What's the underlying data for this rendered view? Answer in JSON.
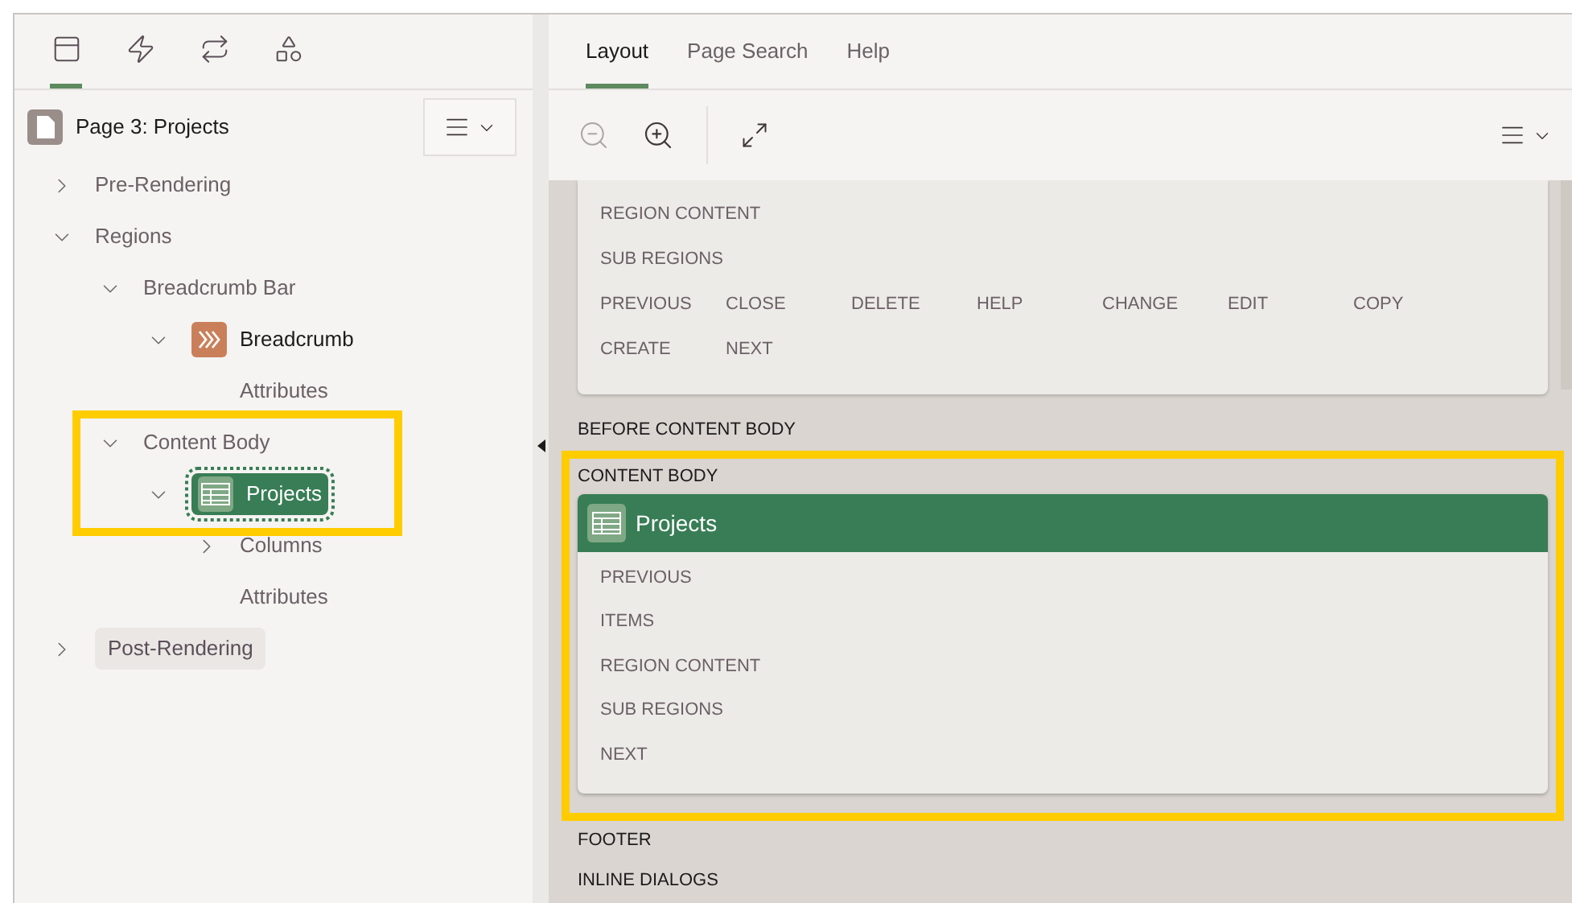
{
  "left_tabs": [
    {
      "selected": true
    },
    {
      "selected": false
    },
    {
      "selected": false
    },
    {
      "selected": false
    }
  ],
  "page_title": "Page 3: Projects",
  "tree": [
    {
      "label": "Pre-Rendering",
      "kind": "folder",
      "expanded": false,
      "selected": false
    },
    {
      "label": "Regions",
      "kind": "folder",
      "expanded": true,
      "selected": false,
      "children": [
        {
          "label": "Breadcrumb Bar",
          "kind": "folder",
          "expanded": true,
          "selected": false,
          "children": [
            {
              "label": "Breadcrumb",
              "kind": "breadcrumb-region",
              "expanded": true,
              "selected": false,
              "children": [
                {
                  "label": "Attributes",
                  "kind": "leaf",
                  "selected": false
                }
              ]
            }
          ]
        },
        {
          "label": "Content Body",
          "kind": "folder",
          "expanded": true,
          "selected": false,
          "highlighted": true,
          "children": [
            {
              "label": "Projects",
              "kind": "table-region",
              "expanded": true,
              "selected": true,
              "children": [
                {
                  "label": "Columns",
                  "kind": "folder",
                  "expanded": false,
                  "selected": false
                },
                {
                  "label": "Attributes",
                  "kind": "leaf",
                  "selected": false
                }
              ]
            }
          ]
        }
      ]
    },
    {
      "label": "Post-Rendering",
      "kind": "folder",
      "expanded": false,
      "selected": false,
      "hovered": true
    }
  ],
  "right_tabs": [
    {
      "label": "Layout",
      "selected": true
    },
    {
      "label": "Page Search",
      "selected": false
    },
    {
      "label": "Help",
      "selected": false
    }
  ],
  "top_card": {
    "rows": [
      "REGION CONTENT",
      "SUB REGIONS"
    ],
    "buttons": [
      "PREVIOUS",
      "CLOSE",
      "DELETE",
      "HELP",
      "CHANGE",
      "EDIT",
      "COPY",
      "CREATE",
      "NEXT"
    ]
  },
  "sections": [
    {
      "label": "BEFORE CONTENT BODY",
      "highlighted": false
    },
    {
      "label": "CONTENT BODY",
      "highlighted": true,
      "region": {
        "title": "Projects",
        "rows": [
          "PREVIOUS",
          "ITEMS",
          "REGION CONTENT",
          "SUB REGIONS",
          "NEXT"
        ]
      }
    },
    {
      "label": "FOOTER",
      "highlighted": false
    },
    {
      "label": "INLINE DIALOGS",
      "highlighted": false
    }
  ]
}
